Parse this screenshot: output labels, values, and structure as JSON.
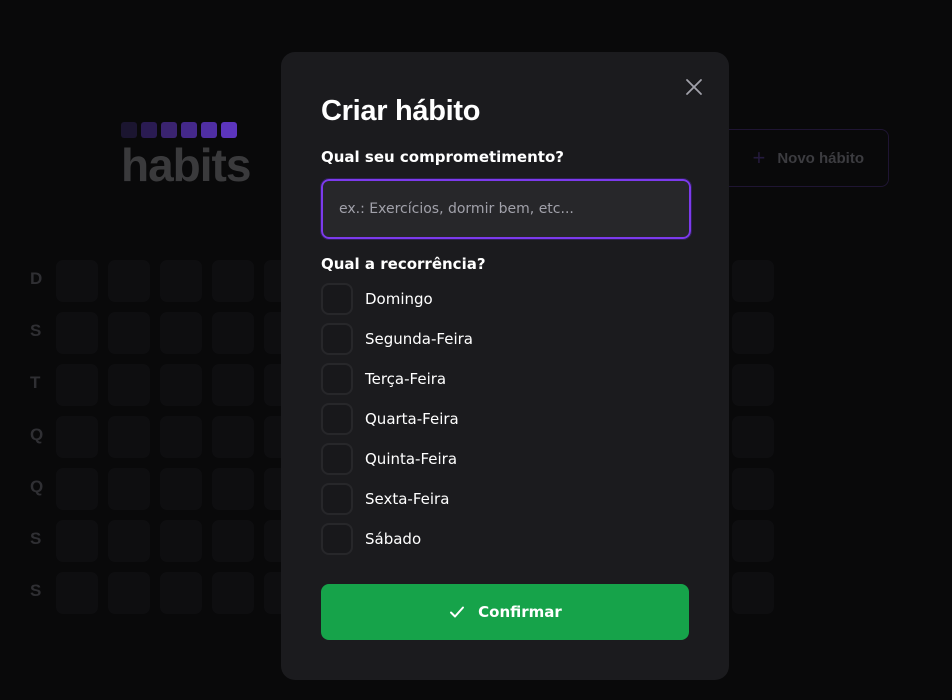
{
  "app": {
    "logo_text": "habits",
    "logo_square_colors": [
      "#1b1530",
      "#2a1b52",
      "#3a2370",
      "#44288a",
      "#4f2ea3",
      "#5c35bd"
    ],
    "new_habit_label": "Novo hábito",
    "weekdays": [
      "D",
      "S",
      "T",
      "Q",
      "Q",
      "S",
      "S"
    ]
  },
  "modal": {
    "title": "Criar hábito",
    "commitment_label": "Qual seu comprometimento?",
    "commitment_placeholder": "ex.: Exercícios, dormir bem, etc...",
    "commitment_value": "",
    "recurrence_label": "Qual a recorrência?",
    "days": [
      {
        "label": "Domingo",
        "checked": false
      },
      {
        "label": "Segunda-Feira",
        "checked": false
      },
      {
        "label": "Terça-Feira",
        "checked": false
      },
      {
        "label": "Quarta-Feira",
        "checked": false
      },
      {
        "label": "Quinta-Feira",
        "checked": false
      },
      {
        "label": "Sexta-Feira",
        "checked": false
      },
      {
        "label": "Sábado",
        "checked": false
      }
    ],
    "confirm_label": "Confirmar"
  },
  "colors": {
    "accent": "#7c3aed",
    "confirm": "#16a34a",
    "modal_bg": "#1b1b1e",
    "page_bg": "#09090a"
  }
}
